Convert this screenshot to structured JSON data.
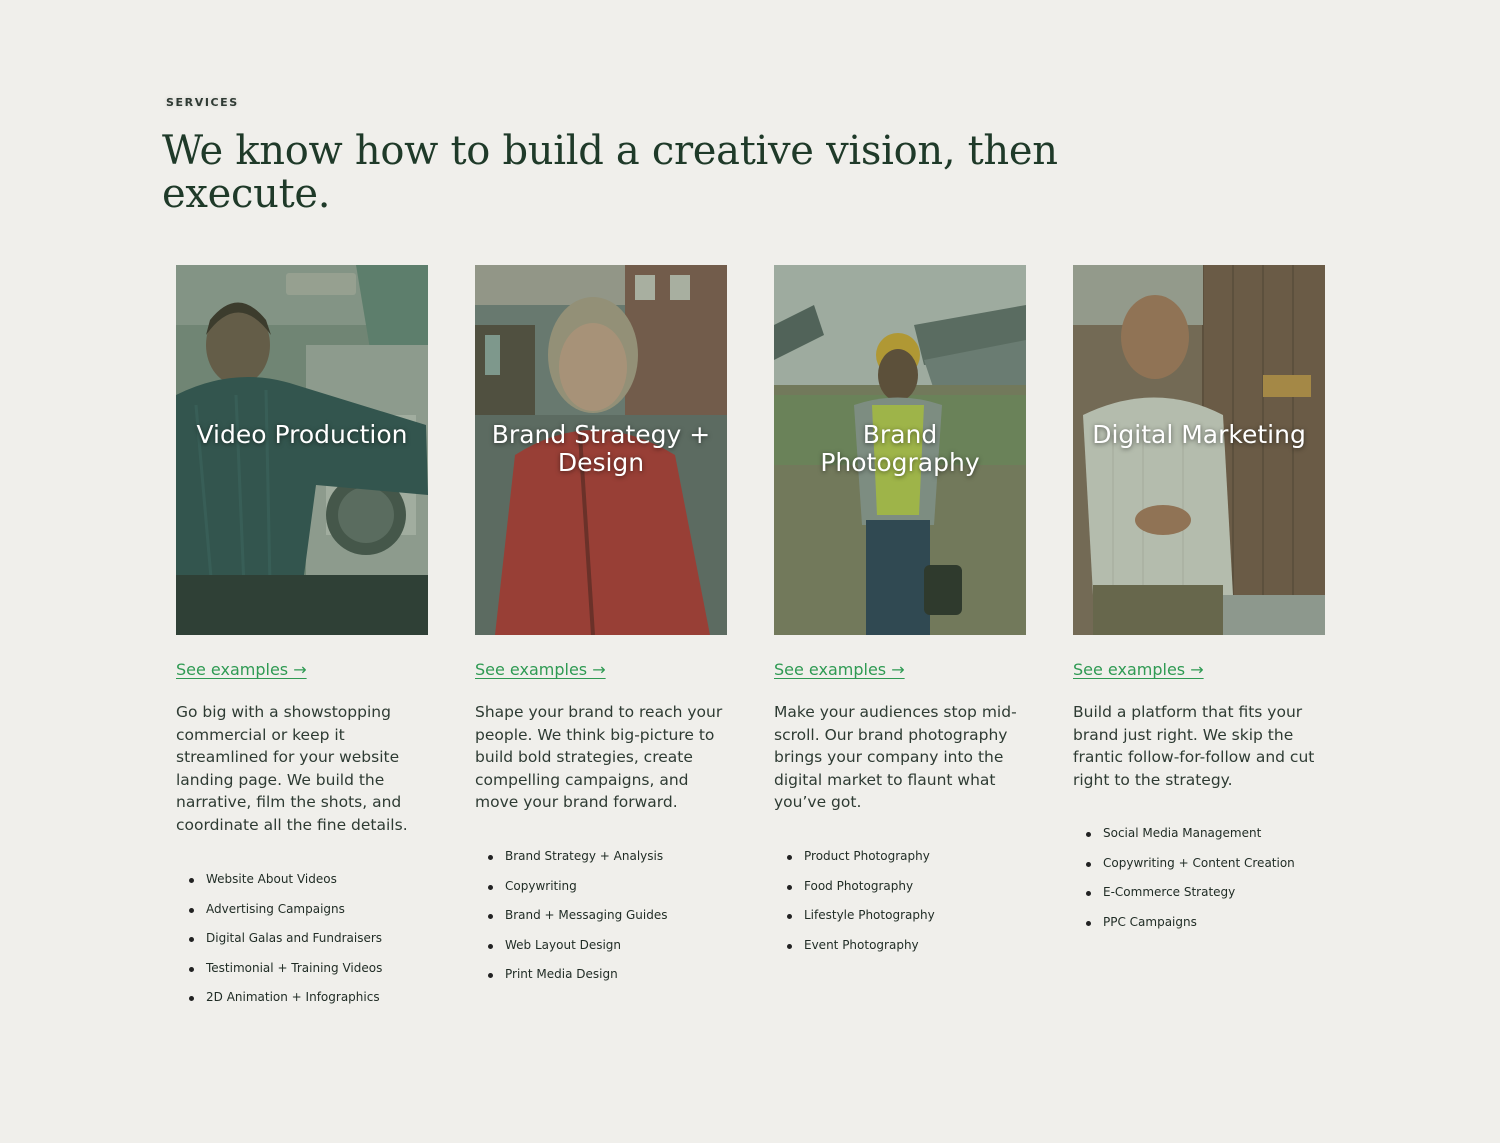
{
  "section": {
    "eyebrow": "SERVICES",
    "headline": "We know how to build a creative vision, then execute."
  },
  "colors": {
    "background": "#f0efeb",
    "heading": "#1f3a29",
    "link": "#2f9a53",
    "body_text": "#2e3b33"
  },
  "cards": [
    {
      "title": "Video Production",
      "link_label": "See examples →",
      "description": "Go big with a showstopping commercial or keep it streamlined for your website landing page. We build the narrative, film the shots, and coordinate all the fine details.",
      "features": [
        "Website About Videos",
        "Advertising Campaigns",
        "Digital Galas and Fundraisers",
        "Testimonial + Training Videos",
        "2D Animation + Infographics"
      ]
    },
    {
      "title": "Brand Strategy + Design",
      "link_label": "See examples →",
      "description": "Shape your brand to reach your people. We think big-picture to build bold strategies, create compelling campaigns, and move your brand forward.",
      "features": [
        "Brand Strategy + Analysis",
        "Copywriting",
        "Brand + Messaging Guides",
        "Web Layout Design",
        "Print Media Design"
      ]
    },
    {
      "title": "Brand Photography",
      "link_label": "See examples →",
      "description": "Make your audiences stop mid-scroll. Our brand photography brings your company into the digital market to flaunt what you’ve got.",
      "features": [
        "Product Photography",
        "Food Photography",
        "Lifestyle Photography",
        "Event Photography"
      ]
    },
    {
      "title": "Digital Marketing",
      "link_label": "See examples →",
      "description": "Build a platform that fits your brand just right. We skip the frantic follow-for-follow and cut right to the strategy.",
      "features": [
        "Social Media Management",
        "Copywriting + Content Creation",
        "E-Commerce Strategy",
        "PPC Campaigns"
      ]
    }
  ]
}
